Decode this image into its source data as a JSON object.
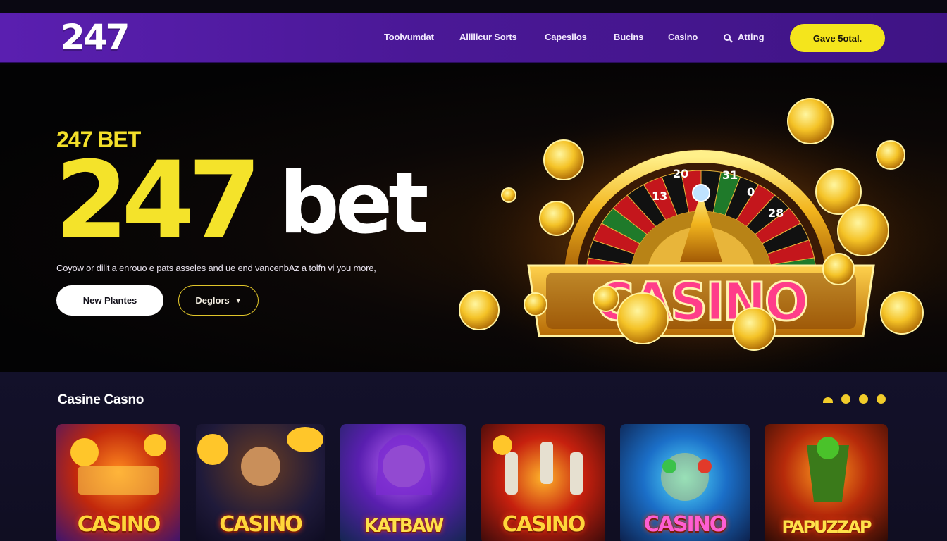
{
  "nav": {
    "logo": "247",
    "items": [
      "Toolvumdat",
      "Allilicur Sorts",
      "Capesilos",
      "Bucins",
      "Casino"
    ],
    "search_label": "Atting",
    "cta_label": "Gave 5otal."
  },
  "hero": {
    "kicker": "247 BET",
    "headline_number": "247",
    "headline_word": "bet",
    "subtitle": "Coyow or dilit a enrouo e pats asseles and ue end vancenbAz a tolfn vi you more,",
    "primary_button": "New Plantes",
    "secondary_button": "Deglors",
    "sign_text": "CASINO",
    "wheel_numbers": [
      "13",
      "20",
      "31",
      "0",
      "28"
    ]
  },
  "games": {
    "title": "Casine Casno",
    "cards": [
      {
        "label": "CASINO"
      },
      {
        "label": "CASINO"
      },
      {
        "label": "KATBAW"
      },
      {
        "label": "CASINO"
      },
      {
        "label": "CASINO"
      },
      {
        "label": "PAPUZZAP"
      }
    ]
  },
  "colors": {
    "nav_purple": "#5a1fb0",
    "accent_yellow": "#f4e51c",
    "hero_bg": "#050408",
    "section_bg": "#13112a"
  }
}
